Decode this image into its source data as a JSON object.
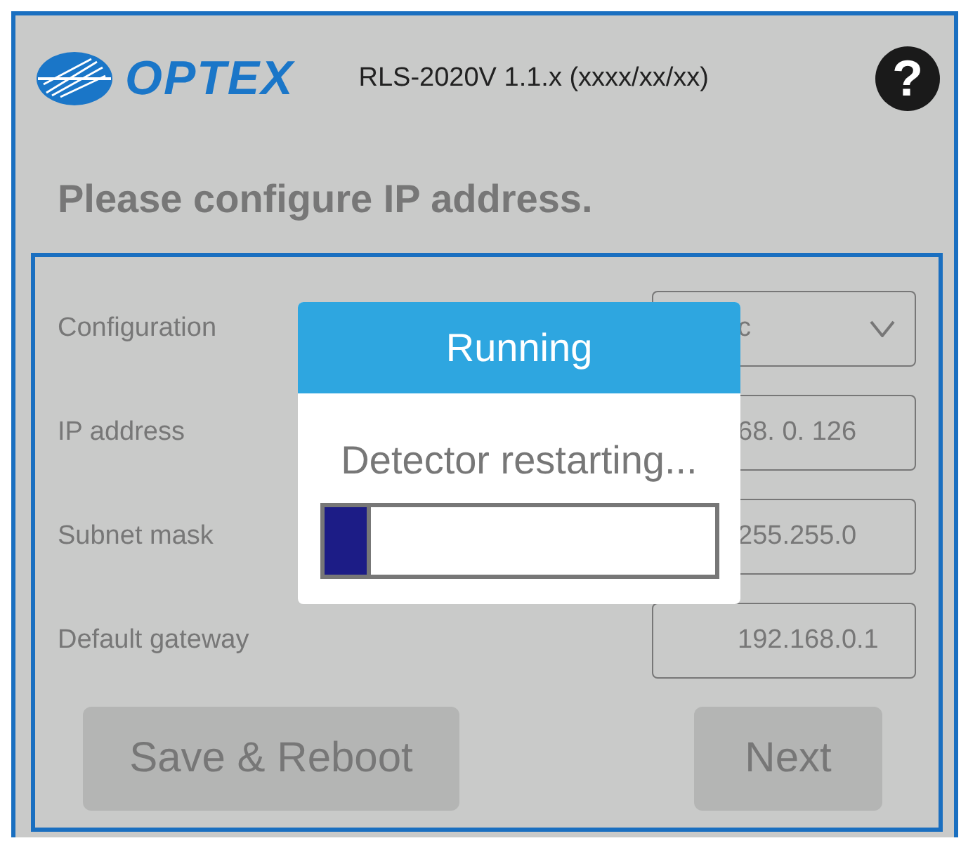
{
  "header": {
    "logo": "OPTEX",
    "version": "RLS-2020V 1.1.x (xxxx/xx/xx)",
    "help": "?"
  },
  "title": "Please configure IP address.",
  "form": {
    "rows": [
      {
        "kind": "dropdown",
        "label": "Configuration",
        "value": "c"
      },
      {
        "kind": "text",
        "label": "IP address",
        "value": "68. 0. 126"
      },
      {
        "kind": "text",
        "label": "Subnet mask",
        "value": "255.255.0"
      },
      {
        "kind": "text",
        "label": "Default gateway",
        "value": "192.168.0.1"
      }
    ],
    "buttons": [
      {
        "label": "Save & Reboot",
        "disabled": true
      },
      {
        "label": "Next",
        "disabled": true
      }
    ]
  },
  "dialog": {
    "title": "Running",
    "message": "Detector restarting...",
    "progress": {
      "level": 0.12
    }
  }
}
